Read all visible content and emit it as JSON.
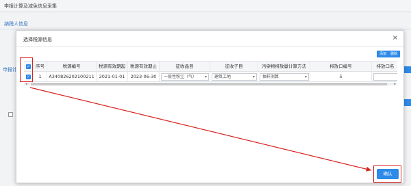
{
  "page": {
    "title": "申报计算及减免信息采集",
    "section1": "纳税人信息",
    "section2": "申报计"
  },
  "dialog": {
    "title": "选择税源信息",
    "close_symbol": "×",
    "add_label": "添加",
    "delete_label": "删除",
    "confirm_label": "确认"
  },
  "table": {
    "headers": [
      "序号",
      "税源编号",
      "税源有效期起",
      "税源有效期止",
      "征收品目",
      "征收子目",
      "污染物排放量计算方法",
      "排放口编号",
      "排放口名"
    ],
    "row": {
      "seq": "1",
      "source_id": "A340826202100211",
      "start": "2021-01-01",
      "end": "2023-06-30",
      "item": "一般性粉尘（气）",
      "sub_item": "建筑工地",
      "method": "抽样测算",
      "outlet_no": "5"
    }
  },
  "scroll": {
    "left": "◂",
    "right": "▸"
  },
  "colors": {
    "accent": "#2d8ae8",
    "annotation": "#d8231f"
  }
}
